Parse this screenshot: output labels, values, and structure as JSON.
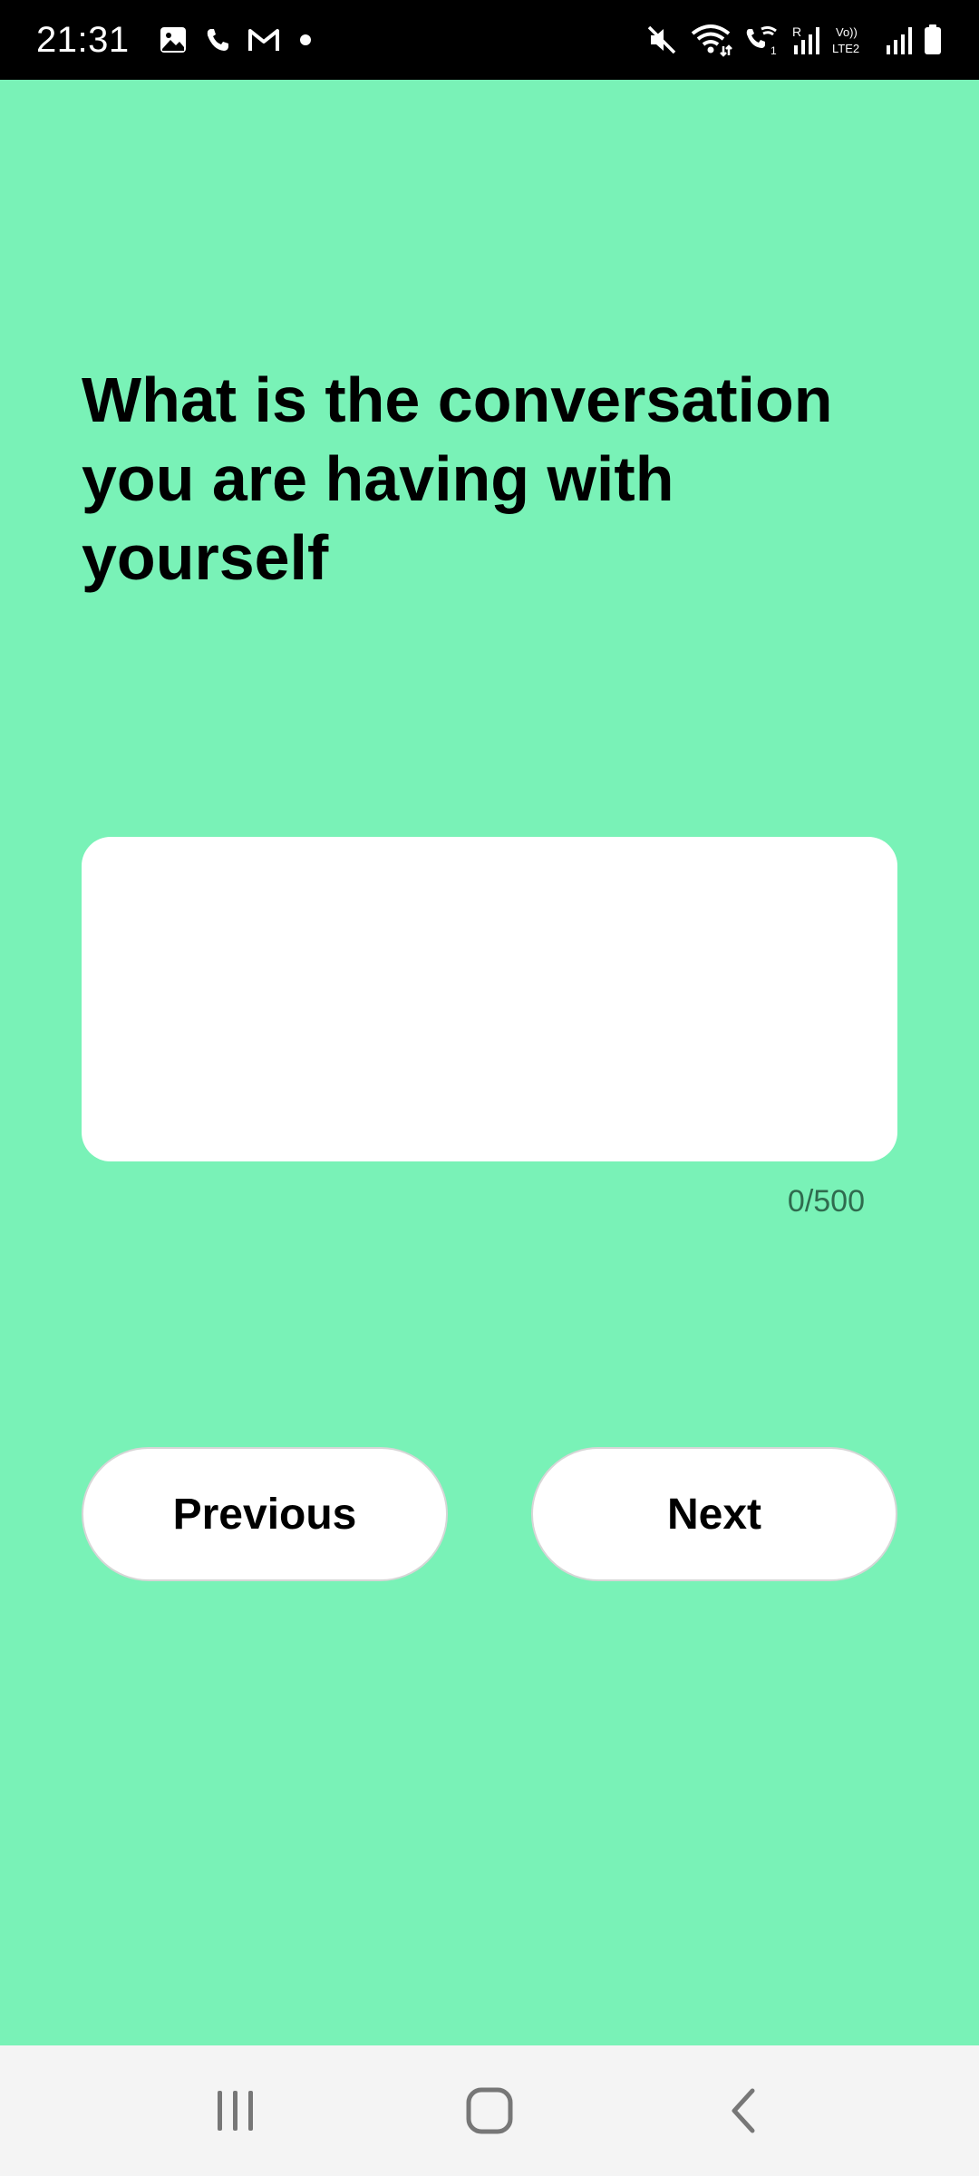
{
  "status_bar": {
    "time": "21:31",
    "icons_left": [
      "gallery-icon",
      "phone-icon",
      "gmail-icon",
      "dot-icon"
    ],
    "icons_right": [
      "mute-icon",
      "wifi-icon",
      "wifi-calling-icon",
      "signal-icon",
      "volte-icon",
      "signal-icon-2",
      "battery-icon"
    ]
  },
  "main": {
    "question": "What is the conversation you are having with yourself",
    "answer": {
      "value": "",
      "placeholder": ""
    },
    "counter": "0/500",
    "buttons": {
      "previous": "Previous",
      "next": "Next"
    }
  },
  "nav_bar": {
    "items": [
      "recent-apps-icon",
      "home-icon",
      "back-icon"
    ]
  },
  "colors": {
    "background": "#79f2b7",
    "status_bar": "#000000",
    "nav_bar": "#f4f4f4",
    "button": "#ffffff",
    "text": "#000000"
  }
}
